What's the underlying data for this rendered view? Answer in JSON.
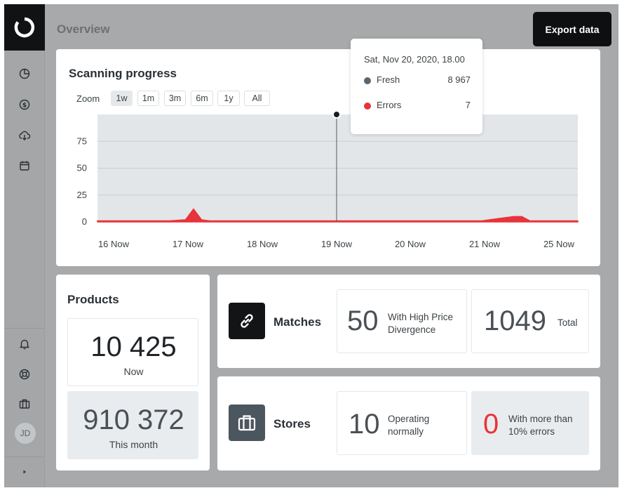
{
  "header": {
    "title": "Overview",
    "export_label": "Export data"
  },
  "sidebar": {
    "logo_icon": "spinner-logo-icon",
    "top_items": [
      {
        "icon": "pie-chart-icon"
      },
      {
        "icon": "dollar-circle-icon"
      },
      {
        "icon": "cloud-download-icon"
      },
      {
        "icon": "calendar-icon"
      }
    ],
    "bottom_items": [
      {
        "icon": "bell-icon"
      },
      {
        "icon": "lifebuoy-icon"
      },
      {
        "icon": "briefcase-icon"
      }
    ],
    "avatar_initials": "JD",
    "expand_icon": "caret-right-icon"
  },
  "scanning": {
    "title": "Scanning progress",
    "zoom_label": "Zoom",
    "zoom_options": [
      "1w",
      "1m",
      "3m",
      "6m",
      "1y",
      "All"
    ],
    "zoom_selected": "1w",
    "tooltip": {
      "date": "Sat, Nov 20, 2020, 18.00",
      "rows": [
        {
          "name": "Fresh",
          "value": "8 967",
          "color": "#5b6770"
        },
        {
          "name": "Errors",
          "value": "7",
          "color": "#e8333a"
        }
      ]
    }
  },
  "chart_data": {
    "type": "area",
    "x_ticks": [
      "16 Now",
      "17 Now",
      "18 Now",
      "19 Now",
      "20 Now",
      "21 Now",
      "25 Now"
    ],
    "y_ticks": [
      0,
      25,
      50,
      75
    ],
    "ylim": [
      0,
      100
    ],
    "grid": true,
    "series": [
      {
        "name": "Errors",
        "color": "#e8333a",
        "x": [
          0,
          0.9,
          1.1,
          1.2,
          1.3,
          1.4,
          2,
          3,
          4,
          4.8,
          5.0,
          5.2,
          5.3,
          5.4,
          6
        ],
        "values": [
          1,
          1,
          2,
          12,
          2,
          1,
          1,
          1,
          1,
          1,
          3,
          5,
          5,
          1,
          1
        ]
      }
    ],
    "hover_x": "19 Now"
  },
  "products": {
    "title": "Products",
    "now_value": "10 425",
    "now_label": "Now",
    "month_value": "910 372",
    "month_label": "This month"
  },
  "matches": {
    "title": "Matches",
    "icon": "link-icon",
    "stat1_value": "50",
    "stat1_label": "With High Price Divergence",
    "stat2_value": "1049",
    "stat2_label": "Total"
  },
  "stores": {
    "title": "Stores",
    "icon": "briefcase-icon",
    "stat1_value": "10",
    "stat1_label": "Operating normally",
    "stat2_value": "0",
    "stat2_label": "With more than 10% errors",
    "error_color": "#e8333a"
  }
}
